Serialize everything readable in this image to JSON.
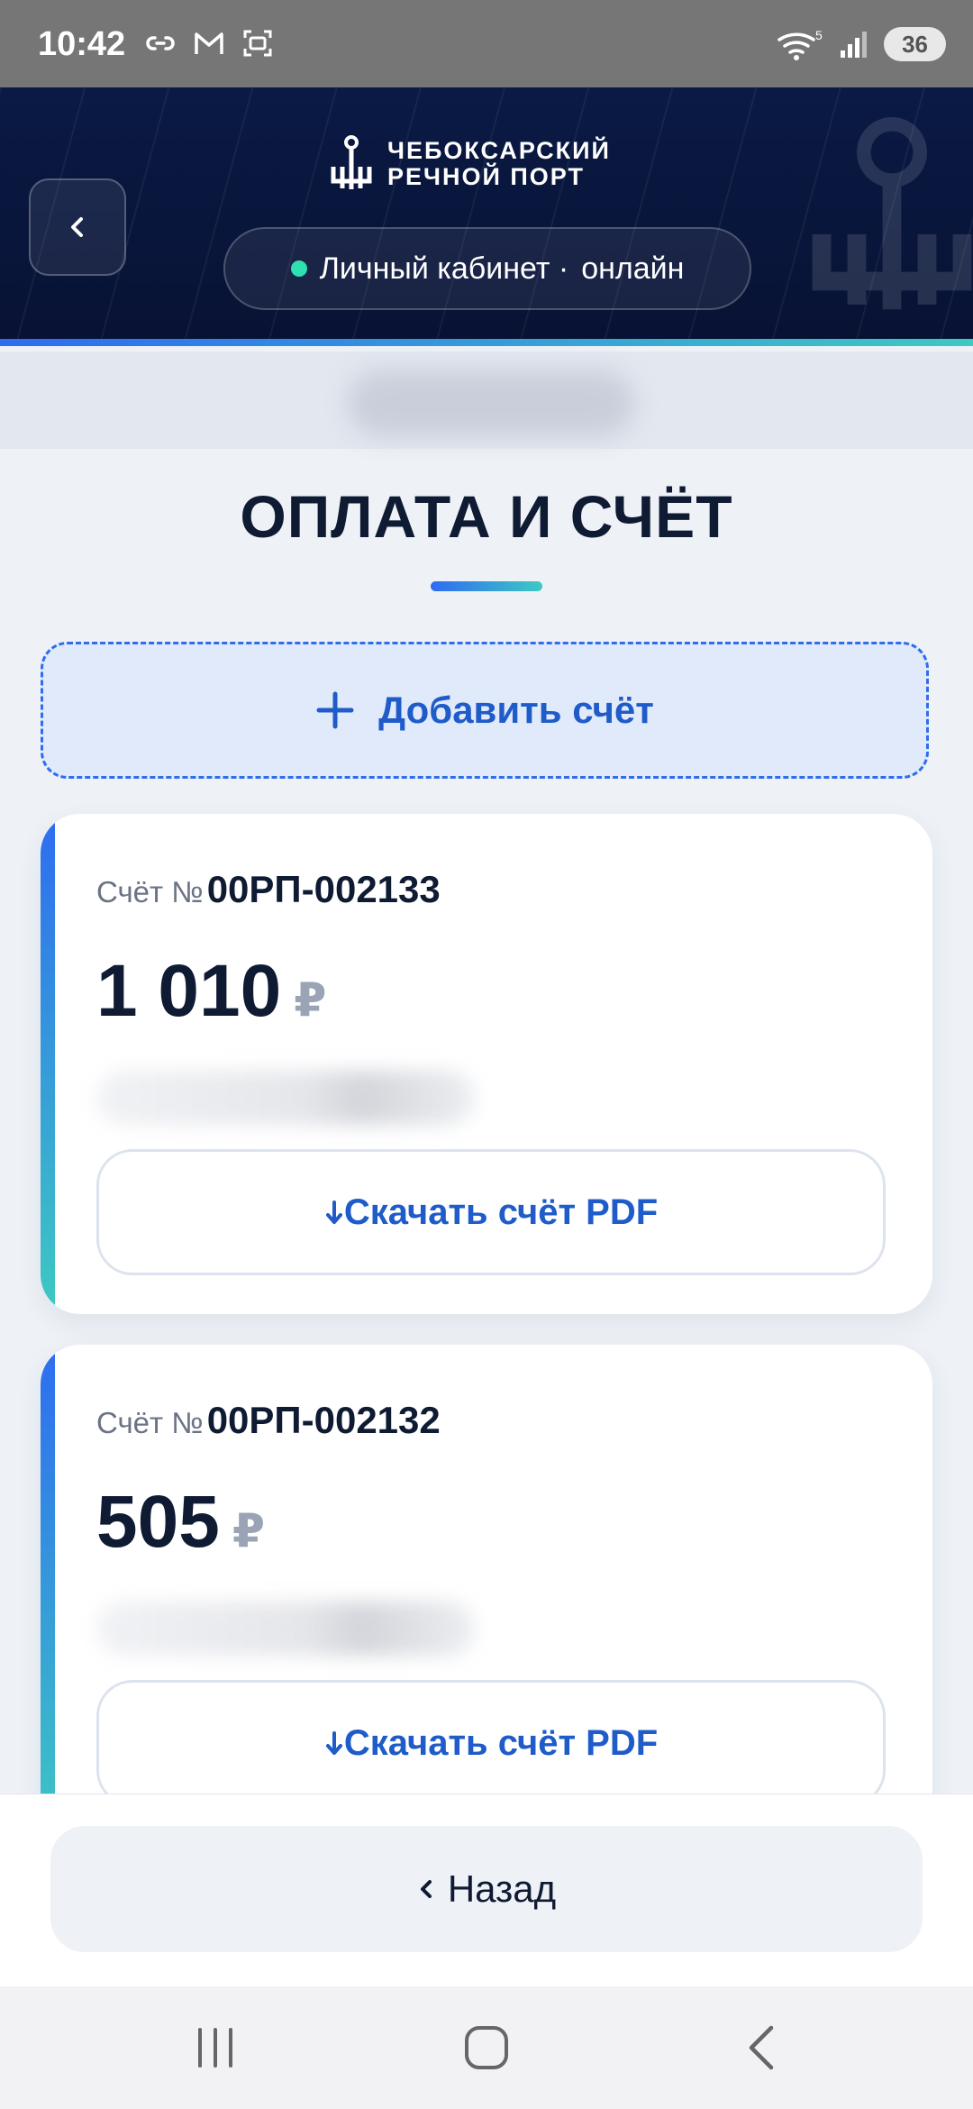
{
  "status_bar": {
    "time": "10:42",
    "icons_left": [
      "link-icon",
      "gmail-icon",
      "screenshot-icon"
    ],
    "wifi_label": "5",
    "battery": "36"
  },
  "header": {
    "logo_line1": "ЧЕБОКСАРСКИЙ",
    "logo_line2": "РЕЧНОЙ ПОРТ",
    "status_label": "Личный кабинет ·",
    "status_value": "онлайн",
    "status_color": "#2fe0b0"
  },
  "page": {
    "title": "ОПЛАТА И СЧЁТ",
    "add_label": "Добавить счёт"
  },
  "invoices": [
    {
      "number_label": "Счёт №",
      "number": "00РП-002133",
      "amount": "1 010",
      "currency": "₽",
      "download_label": "Скачать счёт PDF"
    },
    {
      "number_label": "Счёт №",
      "number": "00РП-002132",
      "amount": "505",
      "currency": "₽",
      "download_label": "Скачать счёт PDF"
    }
  ],
  "footer": {
    "back_label": "Назад"
  },
  "colors": {
    "accent": "#1f5cc9",
    "header_bg": "#0a1a45",
    "gradient_start": "#2e6cf0",
    "gradient_end": "#3ec9c3"
  }
}
